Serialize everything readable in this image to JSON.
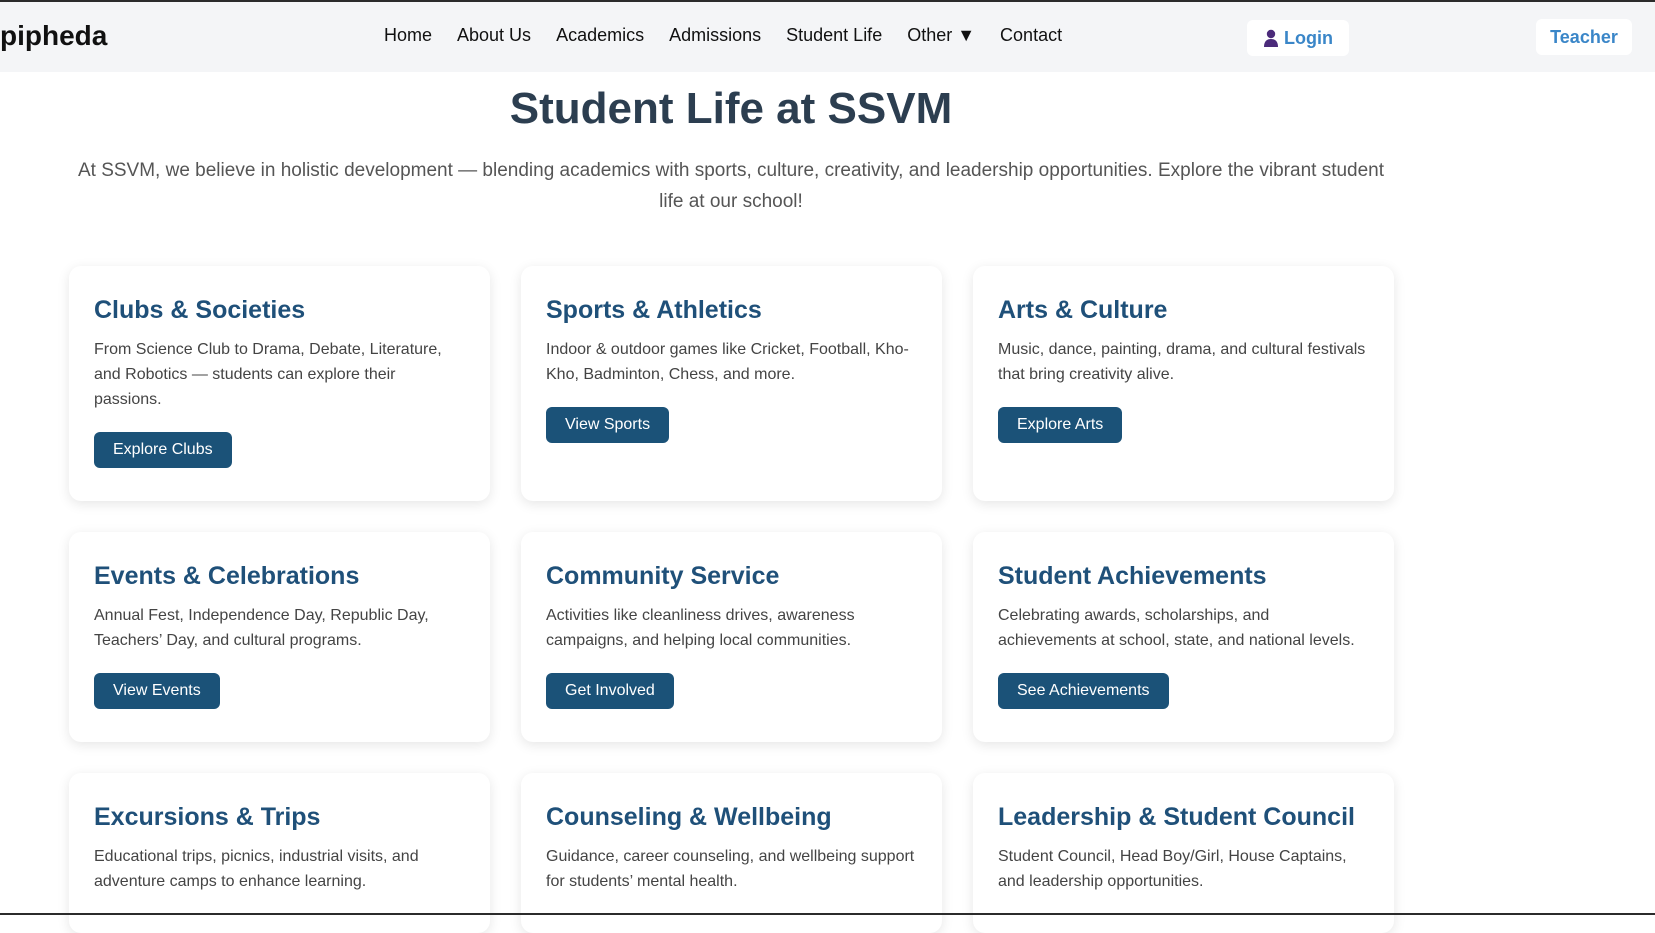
{
  "header": {
    "brand": "pipheda",
    "nav": [
      "Home",
      "About Us",
      "Academics",
      "Admissions",
      "Student Life",
      "Other ▼",
      "Contact"
    ],
    "login_label": "Login",
    "teacher_label": "Teacher"
  },
  "main": {
    "title": "Student Life at SSVM",
    "intro": "At SSVM, we believe in holistic development — blending academics with sports, culture, creativity, and leadership opportunities. Explore the vibrant student life at our school!",
    "cards": [
      {
        "title": "Clubs & Societies",
        "text": "From Science Club to Drama, Debate, Literature, and Robotics — students can explore their passions.",
        "button": "Explore Clubs"
      },
      {
        "title": "Sports & Athletics",
        "text": "Indoor & outdoor games like Cricket, Football, Kho-Kho, Badminton, Chess, and more.",
        "button": "View Sports"
      },
      {
        "title": "Arts & Culture",
        "text": "Music, dance, painting, drama, and cultural festivals that bring creativity alive.",
        "button": "Explore Arts"
      },
      {
        "title": "Events & Celebrations",
        "text": "Annual Fest, Independence Day, Republic Day, Teachers’ Day, and cultural programs.",
        "button": "View Events"
      },
      {
        "title": "Community Service",
        "text": "Activities like cleanliness drives, awareness campaigns, and helping local communities.",
        "button": "Get Involved"
      },
      {
        "title": "Student Achievements",
        "text": "Celebrating awards, scholarships, and achievements at school, state, and national levels.",
        "button": "See Achievements"
      },
      {
        "title": "Excursions & Trips",
        "text": "Educational trips, picnics, industrial visits, and adventure camps to enhance learning.",
        "button": ""
      },
      {
        "title": "Counseling & Wellbeing",
        "text": "Guidance, career counseling, and wellbeing support for students’ mental health.",
        "button": ""
      },
      {
        "title": "Leadership & Student Council",
        "text": "Student Council, Head Boy/Girl, House Captains, and leadership opportunities.",
        "button": ""
      }
    ]
  },
  "icons": {
    "login": "user-icon"
  },
  "colors": {
    "accent": "#1b5278",
    "heading": "#1f5079",
    "link": "#3a86c8",
    "login_icon": "#4b2a7a"
  }
}
